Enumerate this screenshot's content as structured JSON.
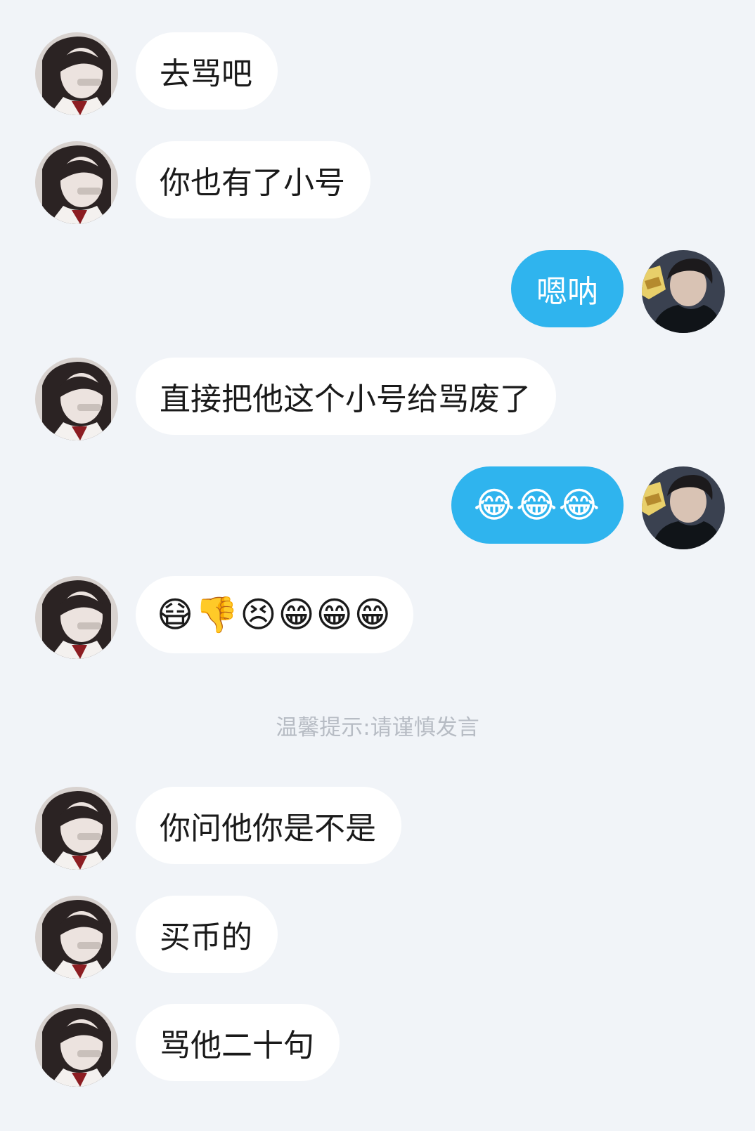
{
  "contacts": {
    "other": {
      "avatar_icon": "girl-avatar-icon"
    },
    "self": {
      "avatar_icon": "boy-avatar-icon"
    }
  },
  "colors": {
    "background": "#f1f4f8",
    "incoming_bubble": "#ffffff",
    "outgoing_bubble": "#2fb4ee",
    "system_text": "#b7bcc4"
  },
  "messages": [
    {
      "side": "in",
      "text": "去骂吧"
    },
    {
      "side": "in",
      "text": "你也有了小号"
    },
    {
      "side": "out",
      "text": "嗯呐"
    },
    {
      "side": "in",
      "text": "直接把他这个小号给骂废了"
    },
    {
      "side": "out",
      "text": "😂😂😂",
      "emoji_names": [
        "tears-of-joy-emoji",
        "tears-of-joy-emoji",
        "tears-of-joy-emoji"
      ]
    },
    {
      "side": "in",
      "text": "😷👎😣😁😁😁",
      "emoji_names": [
        "mask-emoji",
        "thumbs-down-emoji",
        "persevering-face-emoji",
        "grin-emoji",
        "grin-emoji",
        "grin-emoji"
      ]
    },
    {
      "side": "in",
      "text": "你问他你是不是"
    },
    {
      "side": "in",
      "text": "买币的"
    },
    {
      "side": "in",
      "text": "骂他二十句"
    }
  ],
  "system_tip": "温馨提示:请谨慎发言"
}
